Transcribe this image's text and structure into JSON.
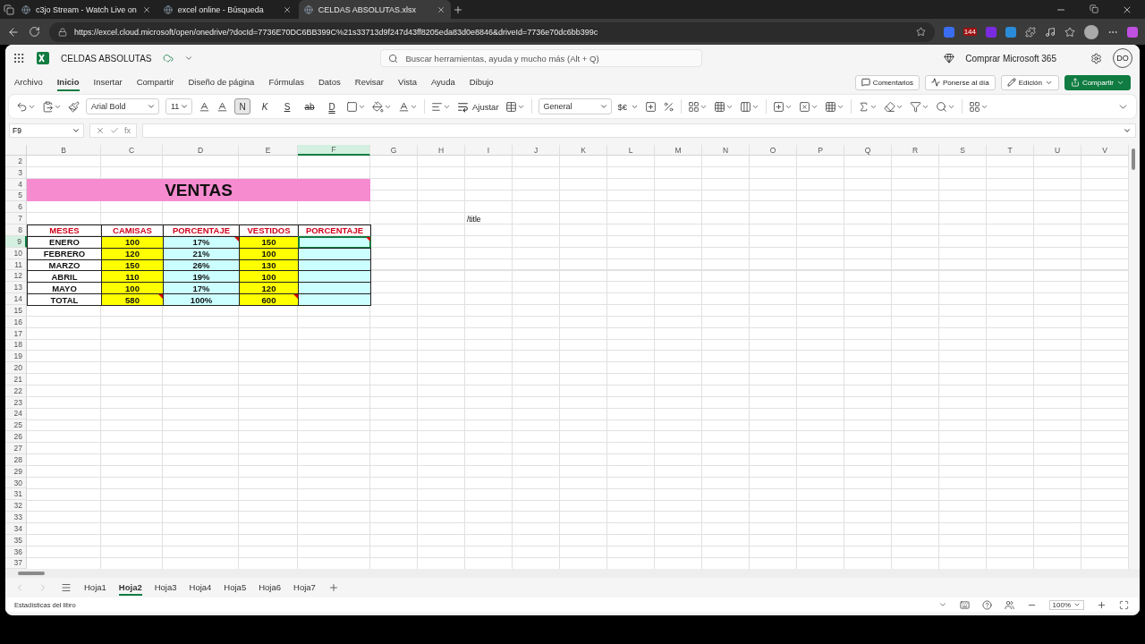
{
  "browser": {
    "tabs": [
      {
        "title": "c3jo Stream - Watch Live on",
        "selected": false
      },
      {
        "title": "excel online - Búsqueda",
        "selected": false
      },
      {
        "title": "CELDAS ABSOLUTAS.xlsx",
        "selected": true
      }
    ],
    "url": "https://excel.cloud.microsoft/open/onedrive/?docId=7736E70DC6BB399C%21s33713d9f247d43ff8205eda83d0e8846&driveId=7736e70dc6bb399c",
    "badge": "144"
  },
  "app": {
    "doc_title": "CELDAS ABSOLUTAS",
    "search_placeholder": "Buscar herramientas, ayuda y mucho más (Alt + Q)",
    "buy": "Comprar Microsoft 365",
    "avatar": "DO"
  },
  "menu": [
    {
      "label": "Archivo",
      "selected": false
    },
    {
      "label": "Inicio",
      "selected": true
    },
    {
      "label": "Insertar",
      "selected": false
    },
    {
      "label": "Compartir",
      "selected": false
    },
    {
      "label": "Diseño de página",
      "selected": false
    },
    {
      "label": "Fórmulas",
      "selected": false
    },
    {
      "label": "Datos",
      "selected": false
    },
    {
      "label": "Revisar",
      "selected": false
    },
    {
      "label": "Vista",
      "selected": false
    },
    {
      "label": "Ayuda",
      "selected": false
    },
    {
      "label": "Dibujo",
      "selected": false
    }
  ],
  "actions": [
    {
      "label": "Comentarios",
      "kind": "comment"
    },
    {
      "label": "Ponerse al día",
      "kind": "activity"
    },
    {
      "label": "Edición",
      "kind": "edit"
    },
    {
      "label": "Compartir",
      "kind": "share"
    }
  ],
  "ribbon": {
    "font": "Arial Bold",
    "size": "11",
    "format_buttons": [
      {
        "label": "N",
        "kind": "bold",
        "selected": true
      },
      {
        "label": "K",
        "kind": "italic",
        "selected": false
      },
      {
        "label": "S",
        "kind": "underline",
        "selected": false
      },
      {
        "label": "ab",
        "kind": "strike",
        "selected": false
      },
      {
        "label": "D",
        "kind": "double",
        "selected": false
      }
    ],
    "wrap": "Ajustar",
    "number_format": "General",
    "currency": "$€"
  },
  "formula_bar": {
    "name_box": "F9",
    "function_label": "fx"
  },
  "sheet": {
    "columns": [
      {
        "label": "B",
        "selected": false
      },
      {
        "label": "C",
        "selected": false
      },
      {
        "label": "D",
        "selected": false
      },
      {
        "label": "E",
        "selected": false
      },
      {
        "label": "F",
        "selected": true
      },
      {
        "label": "G",
        "selected": false
      },
      {
        "label": "H",
        "selected": false
      },
      {
        "label": "I",
        "selected": false
      },
      {
        "label": "J",
        "selected": false
      },
      {
        "label": "K",
        "selected": false
      },
      {
        "label": "L",
        "selected": false
      },
      {
        "label": "M",
        "selected": false
      },
      {
        "label": "N",
        "selected": false
      },
      {
        "label": "O",
        "selected": false
      },
      {
        "label": "P",
        "selected": false
      },
      {
        "label": "Q",
        "selected": false
      },
      {
        "label": "R",
        "selected": false
      },
      {
        "label": "S",
        "selected": false
      },
      {
        "label": "T",
        "selected": false
      },
      {
        "label": "U",
        "selected": false
      },
      {
        "label": "V",
        "selected": false
      }
    ],
    "rows": [
      {
        "label": "2",
        "selected": false
      },
      {
        "label": "3",
        "selected": false
      },
      {
        "label": "4",
        "selected": false
      },
      {
        "label": "5",
        "selected": false
      },
      {
        "label": "6",
        "selected": false
      },
      {
        "label": "7",
        "selected": false
      },
      {
        "label": "8",
        "selected": false
      },
      {
        "label": "9",
        "selected": true
      },
      {
        "label": "10",
        "selected": false
      },
      {
        "label": "11",
        "selected": false
      },
      {
        "label": "12",
        "selected": false
      },
      {
        "label": "13",
        "selected": false
      },
      {
        "label": "14",
        "selected": false
      },
      {
        "label": "15",
        "selected": false
      },
      {
        "label": "16",
        "selected": false
      },
      {
        "label": "17",
        "selected": false
      },
      {
        "label": "18",
        "selected": false
      },
      {
        "label": "19",
        "selected": false
      },
      {
        "label": "20",
        "selected": false
      },
      {
        "label": "21",
        "selected": false
      },
      {
        "label": "22",
        "selected": false
      },
      {
        "label": "23",
        "selected": false
      },
      {
        "label": "24",
        "selected": false
      },
      {
        "label": "25",
        "selected": false
      },
      {
        "label": "26",
        "selected": false
      },
      {
        "label": "27",
        "selected": false
      },
      {
        "label": "28",
        "selected": false
      },
      {
        "label": "29",
        "selected": false
      },
      {
        "label": "30",
        "selected": false
      },
      {
        "label": "31",
        "selected": false
      },
      {
        "label": "32",
        "selected": false
      },
      {
        "label": "33",
        "selected": false
      },
      {
        "label": "34",
        "selected": false
      },
      {
        "label": "35",
        "selected": false
      },
      {
        "label": "36",
        "selected": false
      },
      {
        "label": "37",
        "selected": false
      }
    ],
    "title_cell": {
      "text": "VENTAS",
      "color": "#f78bd0"
    },
    "note_cell": "/title",
    "table": {
      "columns": [
        {
          "header": "MESES",
          "color": "#ffffff"
        },
        {
          "header": "CAMISAS",
          "color": "#ffff00"
        },
        {
          "header": "PORCENTAJE",
          "color": "#ccffff"
        },
        {
          "header": "VESTIDOS",
          "color": "#ffff00"
        },
        {
          "header": "PORCENTAJE",
          "color": "#ccffff"
        }
      ],
      "rows": [
        {
          "cells": [
            {
              "text": "ENERO",
              "flag": false
            },
            {
              "text": "100",
              "flag": false
            },
            {
              "text": "17%",
              "flag": true
            },
            {
              "text": "150",
              "flag": false
            },
            {
              "flag": true
            }
          ]
        },
        {
          "cells": [
            {
              "text": "FEBRERO",
              "flag": false
            },
            {
              "text": "120",
              "flag": false
            },
            {
              "text": "21%",
              "flag": false
            },
            {
              "text": "100",
              "flag": false
            },
            {
              "flag": false
            }
          ]
        },
        {
          "cells": [
            {
              "text": "MARZO",
              "flag": false
            },
            {
              "text": "150",
              "flag": false
            },
            {
              "text": "26%",
              "flag": false
            },
            {
              "text": "130",
              "flag": false
            },
            {
              "flag": false
            }
          ]
        },
        {
          "cells": [
            {
              "text": "ABRIL",
              "flag": false
            },
            {
              "text": "110",
              "flag": false
            },
            {
              "text": "19%",
              "flag": false
            },
            {
              "text": "100",
              "flag": false
            },
            {
              "flag": false
            }
          ]
        },
        {
          "cells": [
            {
              "text": "MAYO",
              "flag": false
            },
            {
              "text": "100",
              "flag": false
            },
            {
              "text": "17%",
              "flag": false
            },
            {
              "text": "120",
              "flag": false
            },
            {
              "flag": false
            }
          ]
        },
        {
          "cells": [
            {
              "text": "TOTAL",
              "flag": false
            },
            {
              "text": "580",
              "flag": true
            },
            {
              "text": "100%",
              "flag": false
            },
            {
              "text": "600",
              "flag": true
            },
            {
              "flag": false
            }
          ]
        }
      ]
    }
  },
  "sheet_tabs": [
    {
      "label": "Hoja1",
      "selected": false
    },
    {
      "label": "Hoja2",
      "selected": true
    },
    {
      "label": "Hoja3",
      "selected": false
    },
    {
      "label": "Hoja4",
      "selected": false
    },
    {
      "label": "Hoja5",
      "selected": false
    },
    {
      "label": "Hoja6",
      "selected": false
    },
    {
      "label": "Hoja7",
      "selected": false
    }
  ],
  "status_bar": {
    "stats": "Estadísticas del libro",
    "zoom": "100%"
  }
}
